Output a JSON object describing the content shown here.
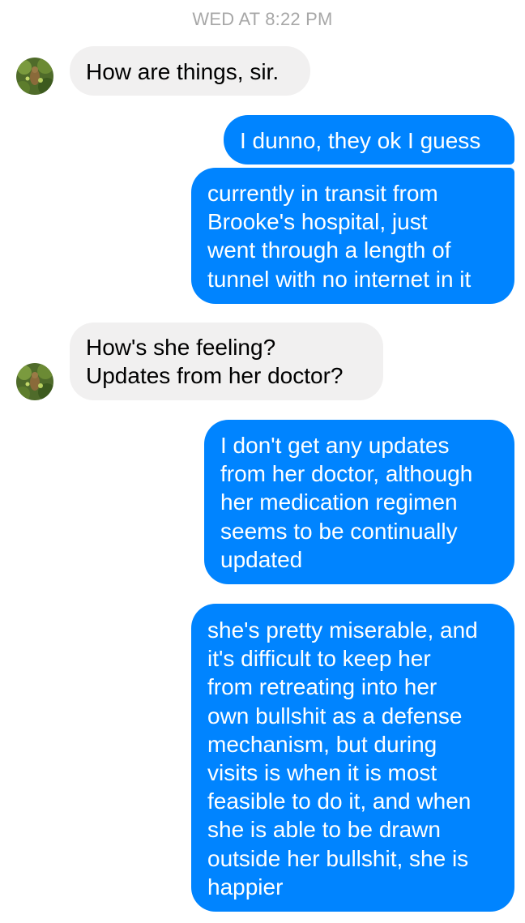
{
  "conversation": {
    "timestamp": "WED AT 8:22 PM",
    "messages": [
      {
        "sender": "contact",
        "text": "How are things, sir."
      },
      {
        "sender": "me",
        "text": "I dunno, they ok I guess"
      },
      {
        "sender": "me",
        "text": "currently in transit from\nBrooke's hospital, just\nwent through a length of\ntunnel with no internet in it"
      },
      {
        "sender": "contact",
        "text": "How's she feeling?\nUpdates from her doctor?"
      },
      {
        "sender": "me",
        "text": "I don't get any updates\nfrom her doctor, although\nher medication regimen\nseems to be continually\nupdated"
      },
      {
        "sender": "me",
        "text": "she's pretty miserable, and\nit's difficult to keep her\nfrom retreating into her\nown bullshit as a defense\nmechanism, but during\nvisits is when it is most\nfeasible to do it, and when\nshe is able to be drawn\noutside her bullshit, she is\nhappier"
      }
    ]
  },
  "colors": {
    "outgoing_bubble": "#0084ff",
    "incoming_bubble": "#f1f0f0",
    "timestamp_text": "#a7a7a7"
  },
  "icons": {
    "contact_avatar": "contact-avatar-photo"
  }
}
